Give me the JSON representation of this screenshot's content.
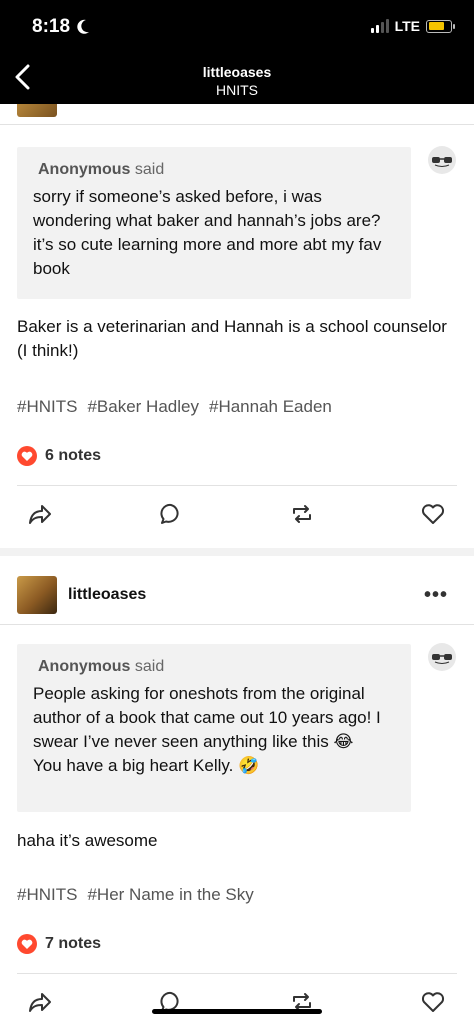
{
  "status": {
    "time": "8:18",
    "network": "LTE",
    "battery_percent": 0.75
  },
  "nav": {
    "blog": "littleoases",
    "subtitle": "HNITS"
  },
  "posts": [
    {
      "ask": {
        "asker": "Anonymous",
        "said": "said",
        "body": "sorry if someone’s asked before, i was wondering what baker and hannah’s jobs are? it’s so cute learning more and more abt my fav book"
      },
      "answer": "Baker is a veterinarian and Hannah is a school counselor (I think!)",
      "tags": [
        "#HNITS",
        "#Baker Hadley",
        "#Hannah Eaden"
      ],
      "notes": "6 notes"
    },
    {
      "blog": "littleoases",
      "more": "•••",
      "ask": {
        "asker": "Anonymous",
        "said": "said",
        "body_line1": "People asking for oneshots from the original author of a book that came out 10 years ago! I swear I’ve never seen anything like this 😂",
        "body_line2": "You have a big heart Kelly. 🤣"
      },
      "answer": "haha it’s awesome",
      "tags": [
        "#HNITS",
        "#Her Name in the Sky"
      ],
      "notes": "7 notes"
    }
  ]
}
